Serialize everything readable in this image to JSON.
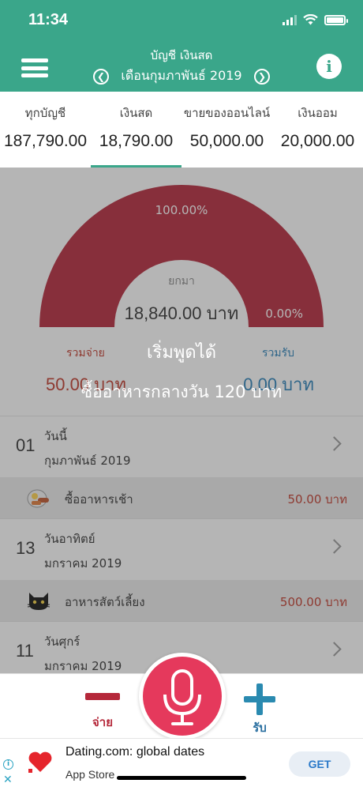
{
  "status_bar": {
    "time": "11:34"
  },
  "header": {
    "account_title": "บัญชี เงินสด",
    "month_label": "เดือนกุมภาพันธ์ 2019",
    "info_symbol": "i",
    "accent_color": "#3aa68a"
  },
  "tabs": [
    {
      "name": "ทุกบัญชี",
      "amount": "187,790.00"
    },
    {
      "name": "เงินสด",
      "amount": "18,790.00",
      "selected": true
    },
    {
      "name": "ขายของออนไลน์",
      "amount": "50,000.00"
    },
    {
      "name": "เงินออม",
      "amount": "20,000.00"
    }
  ],
  "gauge": {
    "expense_percent_label": "100.00%",
    "income_percent_label": "0.00%",
    "expense_fraction": 1.0,
    "brought_forward_label": "ยกมา",
    "brought_forward_amount": "18,840.00 บาท",
    "gauge_color": "#b5283a"
  },
  "totals": {
    "expense_label": "รวมจ่าย",
    "expense_amount": "50.00 บาท",
    "income_label": "รวมรับ",
    "income_amount": "0.00 บาท"
  },
  "list": {
    "day1": {
      "day_num": "01",
      "day_name": "วันนี้",
      "month": "กุมภาพันธ์ 2019"
    },
    "tx1": {
      "icon": "breakfast-icon",
      "name": "ซื้ออาหารเช้า",
      "amount": "50.00 บาท"
    },
    "day2": {
      "day_num": "13",
      "day_name": "วันอาทิตย์",
      "month": "มกราคม 2019"
    },
    "tx2": {
      "icon": "cat-icon",
      "name": "อาหารสัตว์เลี้ยง",
      "amount": "500.00 บาท"
    },
    "day3": {
      "day_num": "11",
      "day_name": "วันศุกร์",
      "month": "มกราคม 2019"
    }
  },
  "voice_overlay": {
    "title": "เริ่มพูดได้",
    "recognized_text": "ซื้ออาหารกลางวัน 120 บาท"
  },
  "bottom_bar": {
    "pay_label": "จ่าย",
    "receive_label": "รับ",
    "mic_color": "#e5395c"
  },
  "ad": {
    "title": "Dating.com: global dates",
    "store": "App Store",
    "cta": "GET",
    "close_symbol": "✕",
    "info_symbol": "i"
  }
}
